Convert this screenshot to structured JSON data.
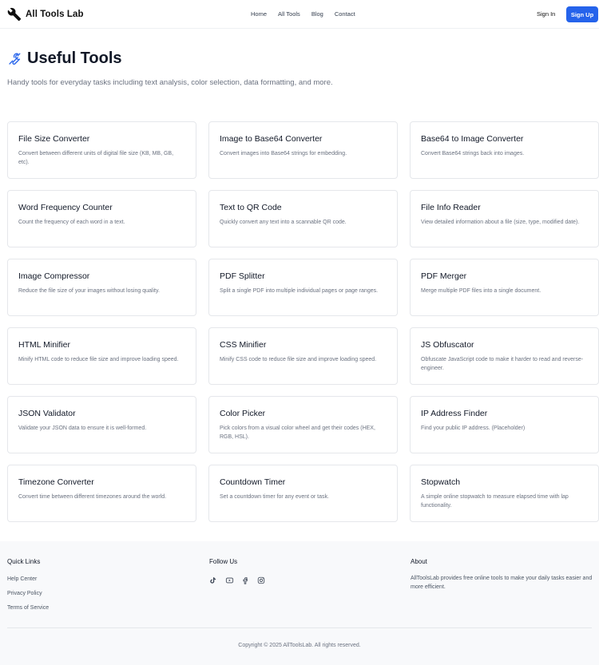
{
  "header": {
    "logo_text": "All Tools Lab",
    "nav": [
      "Home",
      "All Tools",
      "Blog",
      "Contact"
    ],
    "signin_label": "Sign In",
    "signup_label": "Sign Up"
  },
  "hero": {
    "title": "Useful Tools",
    "subtitle": "Handy tools for everyday tasks including text analysis, color selection, data formatting, and more."
  },
  "tools": [
    {
      "title": "File Size Converter",
      "desc": "Convert between different units of digital file size (KB, MB, GB, etc)."
    },
    {
      "title": "Image to Base64 Converter",
      "desc": "Convert images into Base64 strings for embedding."
    },
    {
      "title": "Base64 to Image Converter",
      "desc": "Convert Base64 strings back into images."
    },
    {
      "title": "Word Frequency Counter",
      "desc": "Count the frequency of each word in a text."
    },
    {
      "title": "Text to QR Code",
      "desc": "Quickly convert any text into a scannable QR code."
    },
    {
      "title": "File Info Reader",
      "desc": "View detailed information about a file (size, type, modified date)."
    },
    {
      "title": "Image Compressor",
      "desc": "Reduce the file size of your images without losing quality."
    },
    {
      "title": "PDF Splitter",
      "desc": "Split a single PDF into multiple individual pages or page ranges."
    },
    {
      "title": "PDF Merger",
      "desc": "Merge multiple PDF files into a single document."
    },
    {
      "title": "HTML Minifier",
      "desc": "Minify HTML code to reduce file size and improve loading speed."
    },
    {
      "title": "CSS Minifier",
      "desc": "Minify CSS code to reduce file size and improve loading speed."
    },
    {
      "title": "JS Obfuscator",
      "desc": "Obfuscate JavaScript code to make it harder to read and reverse-engineer."
    },
    {
      "title": "JSON Validator",
      "desc": "Validate your JSON data to ensure it is well-formed."
    },
    {
      "title": "Color Picker",
      "desc": "Pick colors from a visual color wheel and get their codes (HEX, RGB, HSL)."
    },
    {
      "title": "IP Address Finder",
      "desc": "Find your public IP address. (Placeholder)"
    },
    {
      "title": "Timezone Converter",
      "desc": "Convert time between different timezones around the world."
    },
    {
      "title": "Countdown Timer",
      "desc": "Set a countdown timer for any event or task."
    },
    {
      "title": "Stopwatch",
      "desc": "A simple online stopwatch to measure elapsed time with lap functionality."
    }
  ],
  "footer": {
    "quick_links_title": "Quick Links",
    "quick_links": [
      "Help Center",
      "Privacy Policy",
      "Terms of Service"
    ],
    "follow_title": "Follow Us",
    "social_icons": [
      "tiktok-icon",
      "youtube-icon",
      "facebook-icon",
      "instagram-icon"
    ],
    "about_title": "About",
    "about_text": "AllToolsLab provides free online tools to make your daily tasks easier and more efficient.",
    "copyright": "Copyright © 2025 AllToolsLab. All rights reserved."
  },
  "colors": {
    "accent": "#2563eb",
    "footer_bg": "#f8f9fb"
  }
}
